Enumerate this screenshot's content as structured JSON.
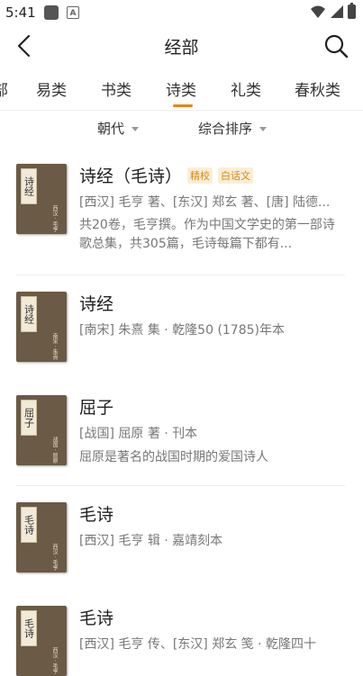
{
  "status": {
    "time": "5:41"
  },
  "nav": {
    "title": "经部"
  },
  "tabs": [
    {
      "label": "部",
      "active": false
    },
    {
      "label": "易类",
      "active": false
    },
    {
      "label": "书类",
      "active": false
    },
    {
      "label": "诗类",
      "active": true
    },
    {
      "label": "礼类",
      "active": false
    },
    {
      "label": "春秋类",
      "active": false
    }
  ],
  "filters": {
    "dynasty": "朝代",
    "sort": "综合排序"
  },
  "colors": {
    "accent": "#e8860c",
    "badge_bg": "#fbeed6",
    "cover": "#6b5a45"
  },
  "books": [
    {
      "title": "诗经（毛诗）",
      "badges": [
        "精校",
        "白话文"
      ],
      "meta": "[西汉] 毛亨 著、[东汉] 郑玄 著、[唐] 陆德...",
      "desc": "共20卷，毛亨撰。作为中国文学史的第一部诗歌总集，共305篇，毛诗每篇下都有...",
      "cover_title": "诗经",
      "cover_sub": "西汉 · 毛亨"
    },
    {
      "title": "诗经",
      "badges": [],
      "meta": "[南宋] 朱熹 集 · 乾隆50 (1785)年本",
      "desc": "",
      "cover_title": "诗经",
      "cover_sub": "南宋 · 朱熹"
    },
    {
      "title": "屈子",
      "badges": [],
      "meta": "[战国] 屈原 著 · 刊本",
      "desc": "屈原是著名的战国时期的爱国诗人",
      "cover_title": "屈子",
      "cover_sub": "战国 · 屈原"
    },
    {
      "title": "毛诗",
      "badges": [],
      "meta": "[西汉] 毛亨 辑 · 嘉靖刻本",
      "desc": "",
      "cover_title": "毛诗",
      "cover_sub": "西汉 · 毛亨"
    },
    {
      "title": "毛诗",
      "badges": [],
      "meta": "[西汉] 毛亨 传、[东汉] 郑玄 笺 · 乾隆四十",
      "desc": "",
      "cover_title": "毛诗",
      "cover_sub": "西汉 · 毛亨"
    }
  ]
}
